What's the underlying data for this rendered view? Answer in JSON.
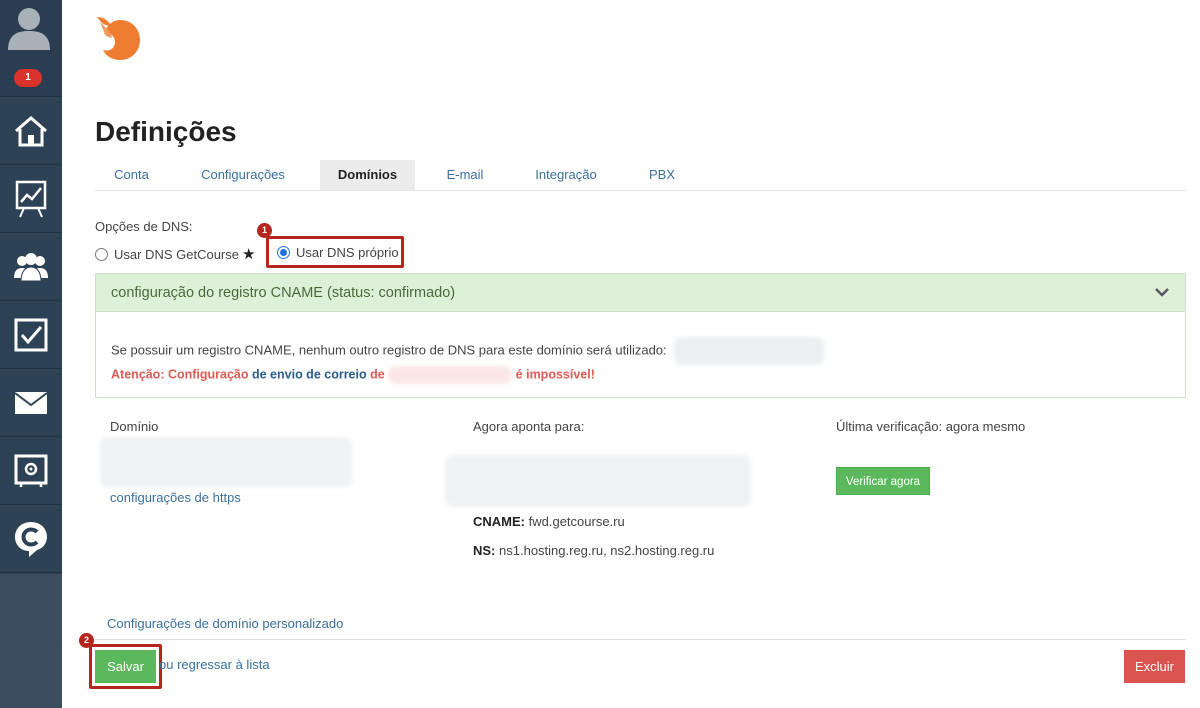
{
  "sidebar": {
    "notification_count": "1",
    "items": [
      {
        "icon": "home-icon"
      },
      {
        "icon": "chart-board-icon"
      },
      {
        "icon": "users-icon"
      },
      {
        "icon": "tasks-icon"
      },
      {
        "icon": "mail-icon"
      },
      {
        "icon": "safe-icon"
      },
      {
        "icon": "chat-c-icon"
      }
    ]
  },
  "page": {
    "title": "Definições"
  },
  "tabs": [
    {
      "label": "Conta"
    },
    {
      "label": "Configurações"
    },
    {
      "label": "Domínios",
      "active": true
    },
    {
      "label": "E-mail"
    },
    {
      "label": "Integração"
    },
    {
      "label": "PBX"
    }
  ],
  "dns": {
    "label": "Opções de DNS:",
    "option_getcourse": "Usar DNS GetCourse",
    "option_own": "Usar DNS próprio",
    "selected": "option_own"
  },
  "annotations": {
    "step1": "1",
    "step2": "2"
  },
  "panel": {
    "title": "configuração do registro CNAME (status: confirmado)",
    "description": "Se possuir um registro CNAME, nenhum outro registro de DNS para este domínio será utilizado:",
    "warn_part1": "Atenção: Configuração",
    "warn_part2": "de envio de correio",
    "warn_part3": "de",
    "warn_part4": "é impossível!"
  },
  "domain": {
    "label_domain": "Domínio",
    "https_link": "configurações de https",
    "label_points_to": "Agora aponta para:",
    "label_last_check": "Última verificação: agora mesmo",
    "verify_button": "Verificar agora",
    "cname_label": "CNAME:",
    "cname_value": "fwd.getcourse.ru",
    "ns_label": "NS:",
    "ns_value": "ns1.hosting.reg.ru, ns2.hosting.reg.ru"
  },
  "footer": {
    "custom_domain_link": "Configurações de domínio personalizado",
    "save_button": "Salvar",
    "back_link": "ou regressar à lista",
    "delete_button": "Excluir"
  },
  "colors": {
    "sidebar_bg": "#2e4256",
    "accent_green": "#5cb85c",
    "danger_red": "#d9534f",
    "annotation_red": "#b5261e",
    "link_blue": "#3a6f9e"
  }
}
